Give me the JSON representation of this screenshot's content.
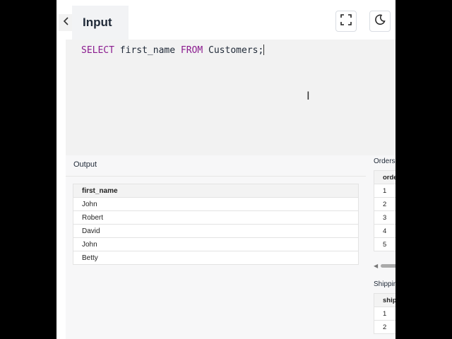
{
  "header": {
    "tab_label": "Input"
  },
  "editor": {
    "kw_select": "SELECT",
    "column": " first_name ",
    "kw_from": "FROM",
    "table": " Customers;"
  },
  "output": {
    "title": "Output",
    "columns": [
      "first_name"
    ],
    "rows": [
      "John",
      "Robert",
      "David",
      "John",
      "Betty"
    ]
  },
  "side_tables": {
    "orders": {
      "title": "Orders",
      "column": "order_id",
      "rows": [
        "1",
        "2",
        "3",
        "4",
        "5"
      ]
    },
    "shippings": {
      "title": "Shippings",
      "column": "shipping_id",
      "rows": [
        "1",
        "2"
      ]
    }
  },
  "icons": {
    "back": "chevron-left-icon",
    "fullscreen": "fullscreen-icon",
    "theme": "moon-icon"
  }
}
